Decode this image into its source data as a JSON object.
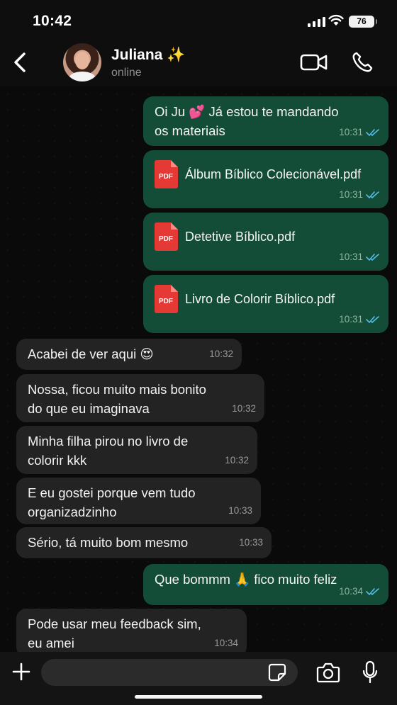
{
  "status_bar": {
    "time": "10:42",
    "battery": "76"
  },
  "header": {
    "contact_name": "Juliana ✨",
    "status": "online"
  },
  "messages": [
    {
      "dir": "out",
      "type": "text",
      "text": "Oi Ju 💕 Já estou te mandando",
      "text2": "os materiais",
      "time": "10:31"
    },
    {
      "dir": "out",
      "type": "file",
      "file_type": "PDF",
      "text": "Álbum Bíblico Colecionável.pdf",
      "time": "10:31"
    },
    {
      "dir": "out",
      "type": "file",
      "file_type": "PDF",
      "text": "Detetive Bíblico.pdf",
      "time": "10:31"
    },
    {
      "dir": "out",
      "type": "file",
      "file_type": "PDF",
      "text": "Livro de Colorir Bíblico.pdf",
      "time": "10:31"
    },
    {
      "dir": "in",
      "type": "text",
      "text": "Acabei de ver aqui 😍",
      "time": "10:32"
    },
    {
      "dir": "in",
      "type": "text",
      "text": "Nossa, ficou muito mais bonito",
      "text2": "do que eu imaginava",
      "time": "10:32"
    },
    {
      "dir": "in",
      "type": "text",
      "text": "Minha filha pirou no livro de",
      "text2": "colorir kkk",
      "time": "10:32"
    },
    {
      "dir": "in",
      "type": "text",
      "text": "E eu gostei porque vem tudo",
      "text2": "organizadzinho",
      "time": "10:33"
    },
    {
      "dir": "in",
      "type": "text",
      "text": "Sério, tá muito bom mesmo",
      "time": "10:33"
    },
    {
      "dir": "out",
      "type": "text",
      "text": "Que bommm 🙏 fico muito feliz",
      "time": "10:34"
    },
    {
      "dir": "in",
      "type": "text",
      "text": "Pode usar meu feedback sim,",
      "text2": "eu amei",
      "time": "10:34"
    }
  ],
  "input": {
    "placeholder": ""
  },
  "colors": {
    "outgoing_bubble": "#144d37",
    "incoming_bubble": "#232323",
    "read_ticks": "#53bdeb",
    "pdf_red": "#e53935"
  },
  "icons": [
    "back-chevron-icon",
    "video-call-icon",
    "phone-icon",
    "pdf-file-icon",
    "read-receipt-icon",
    "plus-icon",
    "sticker-icon",
    "camera-icon",
    "microphone-icon"
  ]
}
